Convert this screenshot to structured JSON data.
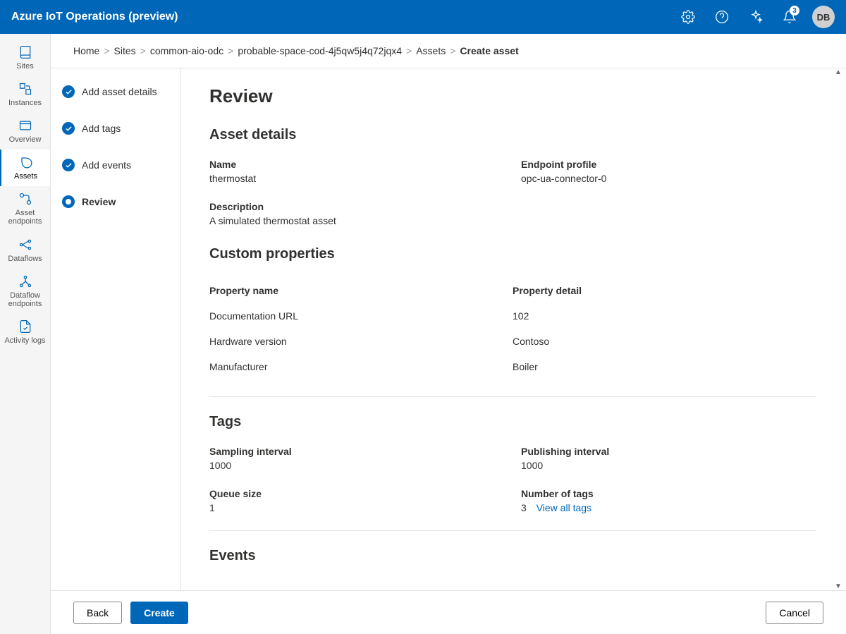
{
  "header": {
    "title": "Azure IoT Operations (preview)",
    "notification_count": "3",
    "avatar_initials": "DB"
  },
  "sidebar": {
    "items": [
      {
        "label": "Sites"
      },
      {
        "label": "Instances"
      },
      {
        "label": "Overview"
      },
      {
        "label": "Assets",
        "active": true
      },
      {
        "label": "Asset endpoints"
      },
      {
        "label": "Dataflows"
      },
      {
        "label": "Dataflow endpoints"
      },
      {
        "label": "Activity logs"
      }
    ]
  },
  "breadcrumb": {
    "items": [
      "Home",
      "Sites",
      "common-aio-odc",
      "probable-space-cod-4j5qw5j4q72jqx4",
      "Assets",
      "Create asset"
    ]
  },
  "steps": [
    {
      "label": "Add asset details",
      "done": true
    },
    {
      "label": "Add tags",
      "done": true
    },
    {
      "label": "Add events",
      "done": true
    },
    {
      "label": "Review",
      "current": true
    }
  ],
  "review": {
    "page_title": "Review",
    "sections": {
      "asset_details": {
        "heading": "Asset details",
        "name_label": "Name",
        "name_value": "thermostat",
        "endpoint_label": "Endpoint profile",
        "endpoint_value": "opc-ua-connector-0",
        "description_label": "Description",
        "description_value": "A simulated thermostat asset"
      },
      "custom_properties": {
        "heading": "Custom properties",
        "col_name": "Property name",
        "col_detail": "Property detail",
        "rows": [
          {
            "name": "Documentation URL",
            "detail": "102"
          },
          {
            "name": "Hardware version",
            "detail": "Contoso"
          },
          {
            "name": "Manufacturer",
            "detail": "Boiler"
          }
        ]
      },
      "tags": {
        "heading": "Tags",
        "sampling_label": "Sampling interval",
        "sampling_value": "1000",
        "publishing_label": "Publishing interval",
        "publishing_value": "1000",
        "queue_label": "Queue size",
        "queue_value": "1",
        "count_label": "Number of tags",
        "count_value": "3",
        "view_all_link": "View all tags"
      },
      "events": {
        "heading": "Events"
      }
    }
  },
  "footer": {
    "back": "Back",
    "create": "Create",
    "cancel": "Cancel"
  }
}
